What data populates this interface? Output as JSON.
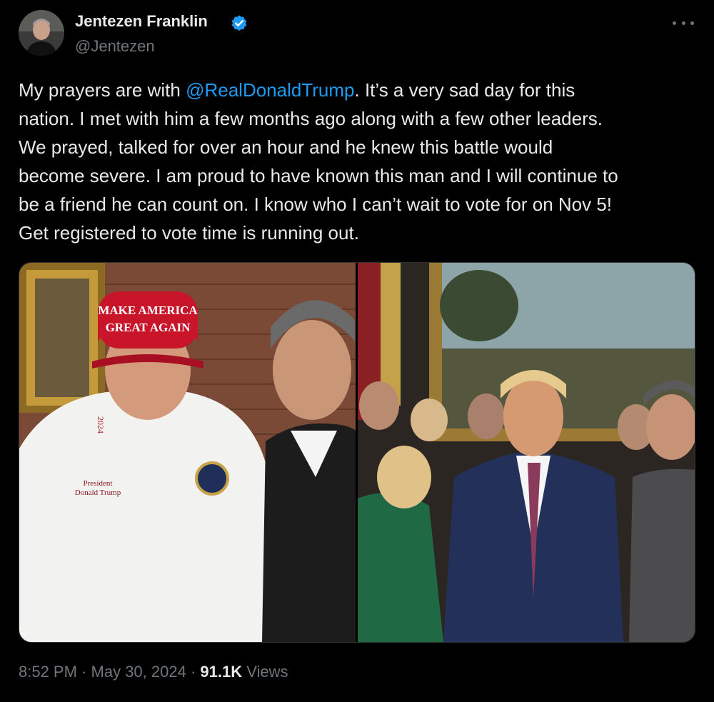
{
  "author": {
    "display_name": "Jentezen Franklin",
    "handle": "@Jentezen",
    "verified": true,
    "verified_color": "#1d9bf0"
  },
  "tweet": {
    "lines": [
      {
        "before": "My prayers are with ",
        "mention": "@RealDonaldTrump",
        "after": ". It’s a very sad day for this"
      },
      {
        "text": "nation. I met with him a few months ago along with a few other leaders."
      },
      {
        "text": "We prayed, talked for over an hour and he knew this battle would"
      },
      {
        "text": "become severe. I am proud to have known this man and I will continue to"
      },
      {
        "text": "be a friend he can count on. I know who I can’t wait to vote for on Nov 5!"
      },
      {
        "text": "Get registered to vote time is running out."
      }
    ]
  },
  "media": {
    "left_photo": {
      "cap_text_line1": "MAKE AMERICA",
      "cap_text_line2": "GREAT AGAIN",
      "shirt_text_line1": "President",
      "shirt_text_line2": "Donald Trump",
      "collar_text": "2024"
    }
  },
  "meta": {
    "time": "8:52 PM",
    "separator": "·",
    "date": "May 30, 2024",
    "views_count": "91.1K",
    "views_label": "Views"
  },
  "colors": {
    "background": "#000000",
    "text": "#e7e9ea",
    "secondary_text": "#71767b",
    "mention": "#1d9bf0"
  },
  "icons": [
    "verified-badge-icon",
    "more-options-icon"
  ]
}
